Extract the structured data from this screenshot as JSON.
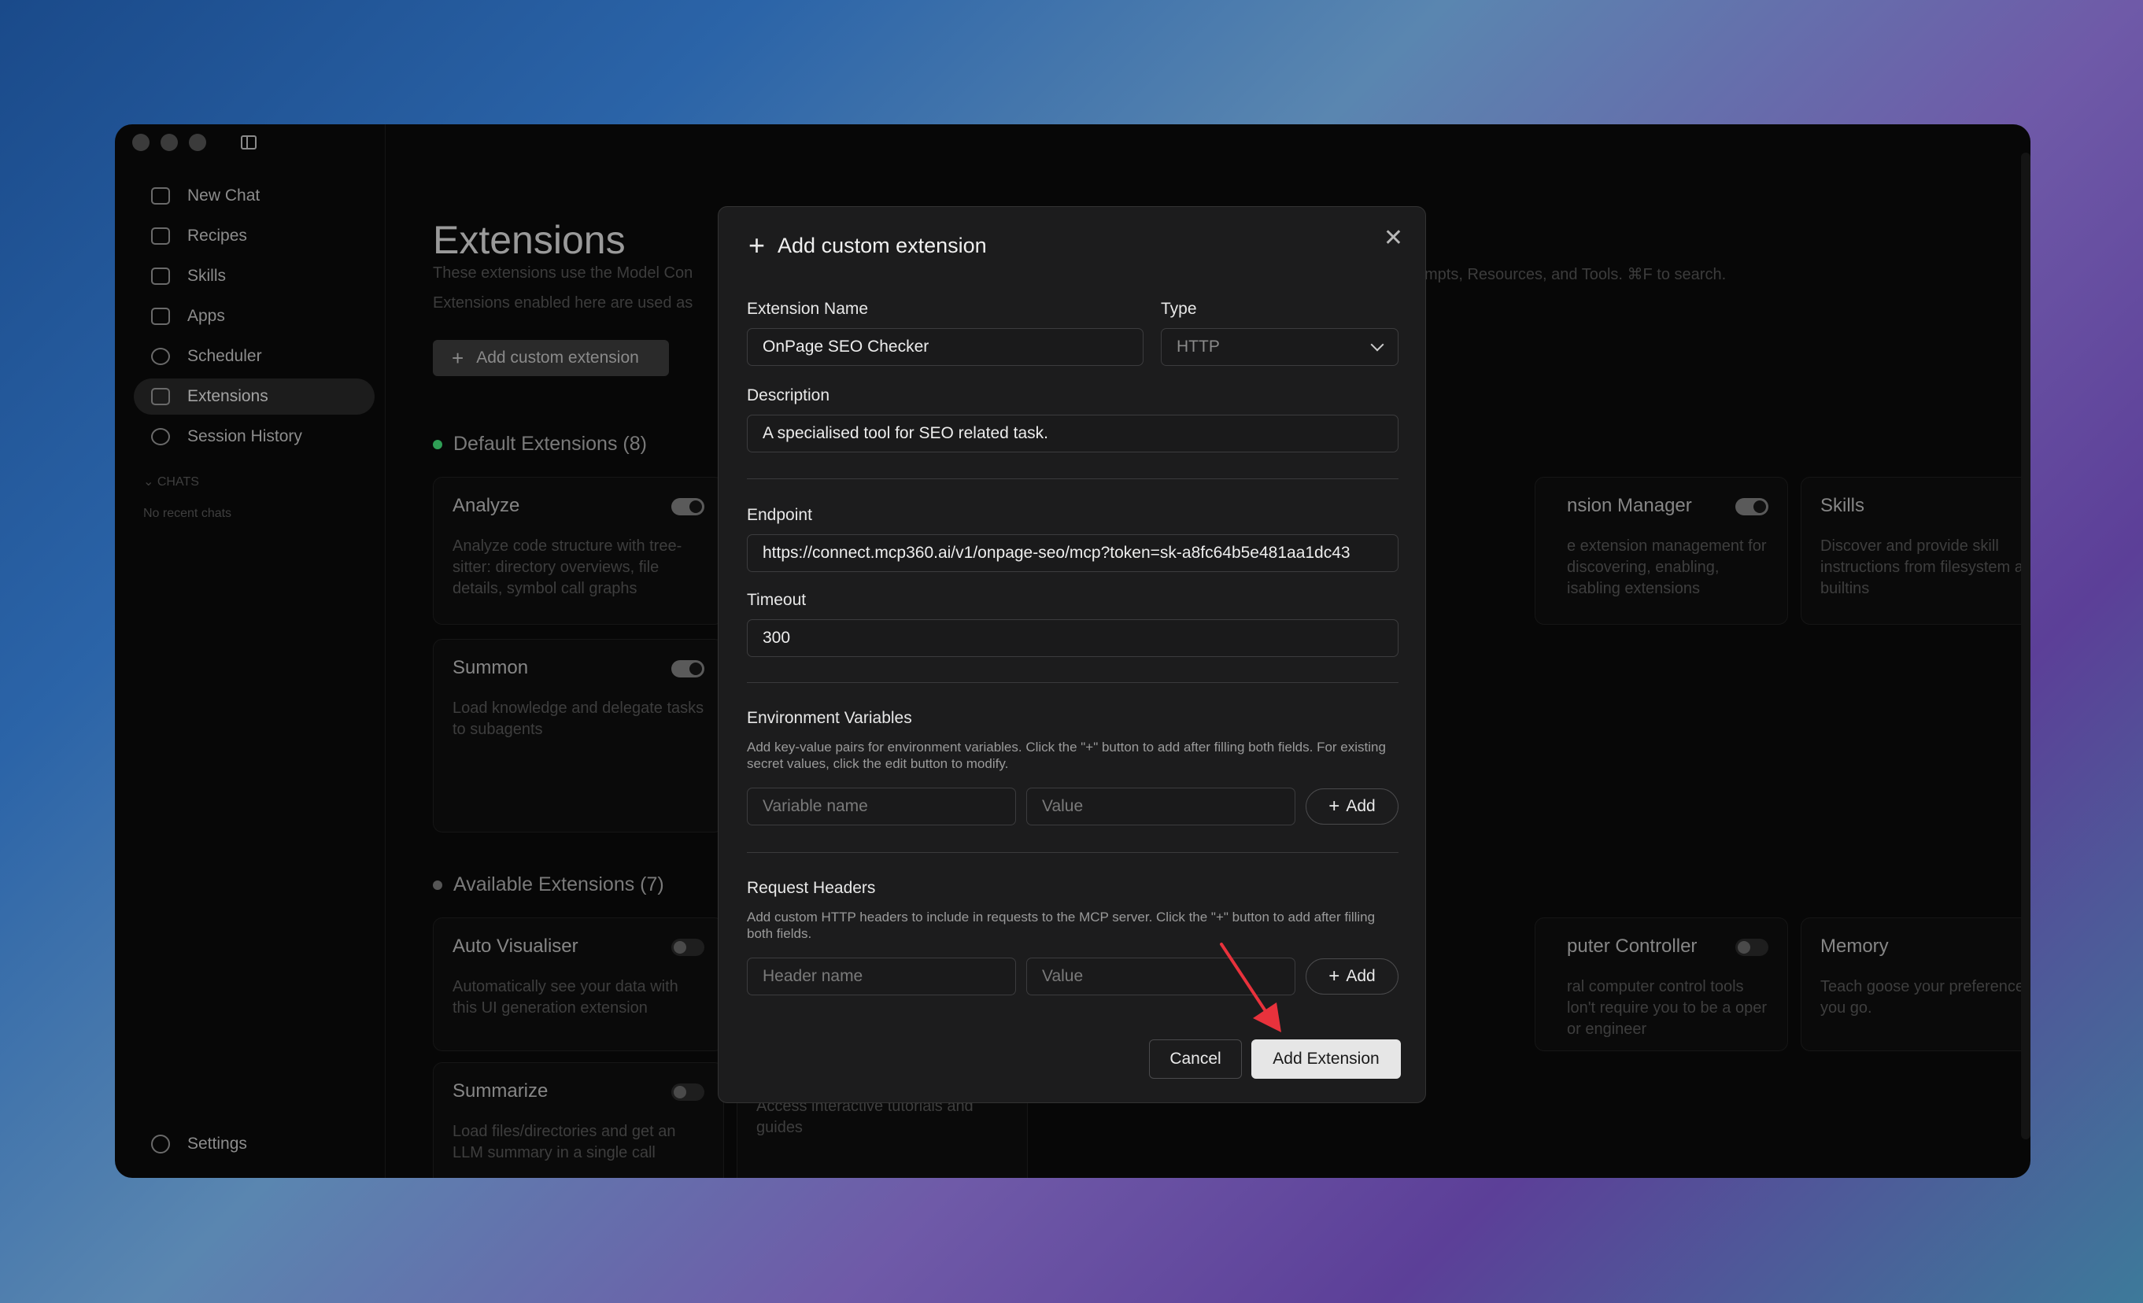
{
  "sidebar": {
    "items": [
      {
        "label": "New Chat",
        "icon": "chat-plus-icon"
      },
      {
        "label": "Recipes",
        "icon": "recipe-icon"
      },
      {
        "label": "Skills",
        "icon": "lightning-icon"
      },
      {
        "label": "Apps",
        "icon": "apps-icon"
      },
      {
        "label": "Scheduler",
        "icon": "clock-icon"
      },
      {
        "label": "Extensions",
        "icon": "puzzle-icon",
        "active": true
      },
      {
        "label": "Session History",
        "icon": "history-icon"
      }
    ],
    "chats_label": "⌄ CHATS",
    "no_chats": "No recent chats",
    "settings_label": "Settings"
  },
  "page": {
    "title": "Extensions",
    "sub1_left": "These extensions use the Model Con",
    "sub1_right": "mpts, Resources, and Tools. ⌘F to search.",
    "sub2": "Extensions enabled here are used as",
    "add_button": "Add custom extension",
    "default_section": "Default Extensions (8)",
    "available_section": "Available Extensions (7)"
  },
  "cards": [
    {
      "title": "Analyze",
      "desc": "Analyze code structure with tree-sitter: directory overviews, file details, symbol call graphs",
      "on": true
    },
    {
      "title": "nsion Manager",
      "desc": "e extension management for discovering, enabling, isabling extensions",
      "on": true
    },
    {
      "title": "Skills",
      "desc": "Discover and provide skill instructions from filesystem and builtins",
      "on": true
    },
    {
      "title": "Summon",
      "desc": "Load knowledge and delegate tasks to subagents",
      "on": true
    },
    {
      "title": "Auto Visualiser",
      "desc": "Automatically see your data with this UI generation extension",
      "on": false
    },
    {
      "title": "puter Controller",
      "desc": "ral computer control tools lon't require you to be a oper or engineer",
      "on": false
    },
    {
      "title": "Memory",
      "desc": "Teach goose your preferences as you go.",
      "on": false
    },
    {
      "title": "Summarize",
      "desc": "Load files/directories and get an LLM summary in a single call",
      "on": false
    },
    {
      "title": "",
      "desc": "Access interactive tutorials and guides",
      "on": false
    }
  ],
  "modal": {
    "title": "Add custom extension",
    "name_label": "Extension Name",
    "name_value": "OnPage SEO Checker",
    "type_label": "Type",
    "type_value": "HTTP",
    "desc_label": "Description",
    "desc_value": "A specialised tool for SEO related task.",
    "endpoint_label": "Endpoint",
    "endpoint_value": "https://connect.mcp360.ai/v1/onpage-seo/mcp?token=sk-a8fc64b5e481aa1dc43",
    "timeout_label": "Timeout",
    "timeout_value": "300",
    "env_label": "Environment Variables",
    "env_help": "Add key-value pairs for environment variables. Click the \"+\" button to add after filling both fields. For existing secret values, click the edit button to modify.",
    "env_name_ph": "Variable name",
    "env_value_ph": "Value",
    "add_label": "Add",
    "headers_label": "Request Headers",
    "headers_help": "Add custom HTTP headers to include in requests to the MCP server. Click the \"+\" button to add after filling both fields.",
    "header_name_ph": "Header name",
    "header_value_ph": "Value",
    "cancel": "Cancel",
    "submit": "Add Extension"
  },
  "colors": {
    "accent_arrow": "#e8323c",
    "toggle_on": "#5a5a5a"
  }
}
